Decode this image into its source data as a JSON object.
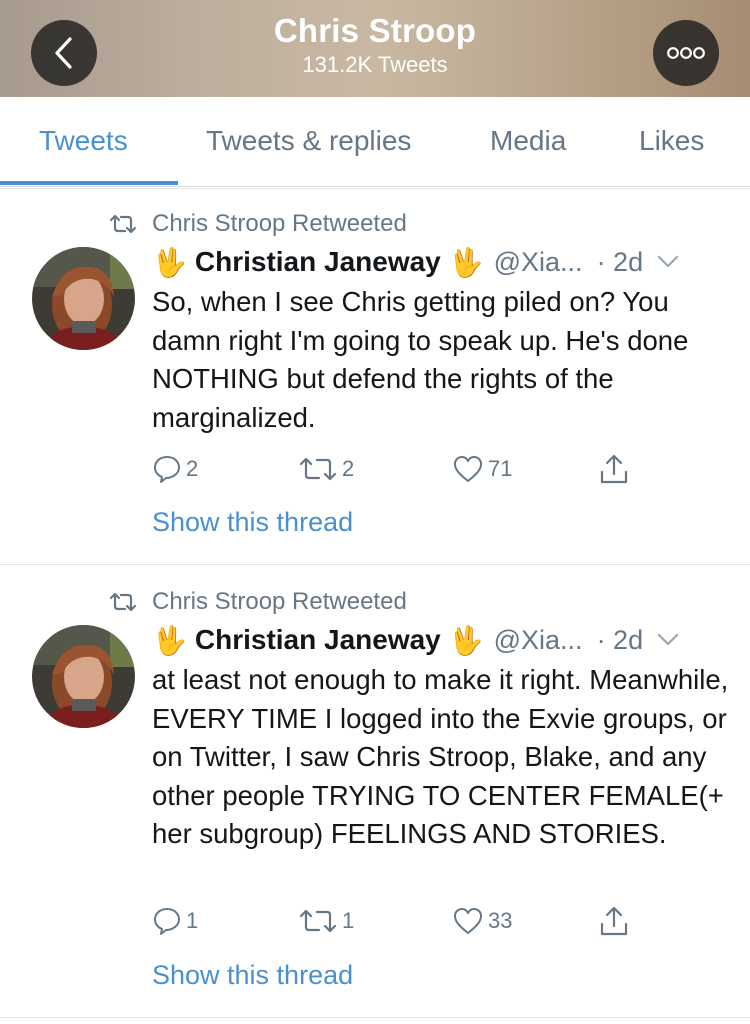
{
  "header": {
    "title": "Chris Stroop",
    "subtitle": "131.2K Tweets",
    "back_icon": "back-chevron-icon",
    "more_icon": "more-dots-icon"
  },
  "tabs": [
    {
      "label": "Tweets",
      "active": true
    },
    {
      "label": "Tweets & replies",
      "active": false
    },
    {
      "label": "Media",
      "active": false
    },
    {
      "label": "Likes",
      "active": false
    }
  ],
  "colors": {
    "accent": "#4a90cf",
    "secondary_text": "#657786",
    "primary_text": "#14171a"
  },
  "tweets": [
    {
      "retweet_label": "Chris Stroop Retweeted",
      "display_name": "Christian Janeway",
      "name_emoji": "🖖",
      "handle": "@Xia...",
      "time": "· 2d",
      "text": "So, when I see Chris getting piled on? You damn right I'm going to speak up. He's done NOTHING but defend the rights of the marginalized.",
      "replies": "2",
      "retweets": "2",
      "likes": "71",
      "thread_link": "Show this thread"
    },
    {
      "retweet_label": "Chris Stroop Retweeted",
      "display_name": "Christian Janeway",
      "name_emoji": "🖖",
      "handle": "@Xia...",
      "time": "· 2d",
      "text": "at least not enough to make it right. Meanwhile, EVERY TIME I logged into the Exvie groups, or on Twitter, I saw Chris Stroop, Blake, and any other people TRYING TO CENTER FEMALE(+ her subgroup) FEELINGS AND STORIES.",
      "replies": "1",
      "retweets": "1",
      "likes": "33",
      "thread_link": "Show this thread"
    }
  ]
}
